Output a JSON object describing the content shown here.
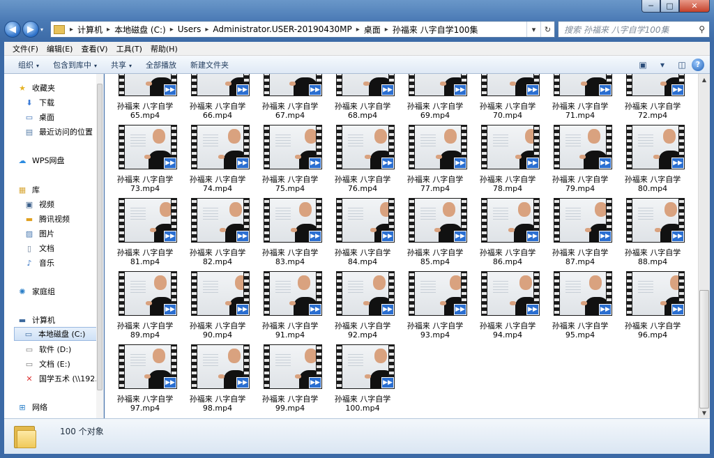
{
  "window": {
    "controls": {
      "minimize": "─",
      "maximize": "□",
      "close": "✕"
    }
  },
  "address": {
    "back_glyph": "◀",
    "forward_glyph": "▶",
    "dropdown_glyph": "▾",
    "crumbs": [
      "计算机",
      "本地磁盘 (C:)",
      "Users",
      "Administrator.USER-20190430MP",
      "桌面",
      "孙福来 八字自学100集"
    ],
    "crumb_sep": "▸",
    "dropdown": "▾",
    "refresh": "↻",
    "search_placeholder": "搜索 孙福来 八字自学100集",
    "search_glyph": "⚲"
  },
  "menubar": [
    "文件(F)",
    "编辑(E)",
    "查看(V)",
    "工具(T)",
    "帮助(H)"
  ],
  "commandbar": {
    "organize": "组织",
    "include_library": "包含到库中",
    "share": "共享",
    "play_all": "全部播放",
    "new_folder": "新建文件夹",
    "dd": "▾",
    "view_glyph": "▣",
    "pane_glyph": "◫",
    "help_glyph": "?"
  },
  "nav": {
    "favorites": "收藏夹",
    "downloads": "下载",
    "desktop": "桌面",
    "recent": "最近访问的位置",
    "wps": "WPS网盘",
    "libraries": "库",
    "videos": "视频",
    "tencent_video": "腾讯视频",
    "pictures": "图片",
    "documents": "文档",
    "music": "音乐",
    "homegroup": "家庭组",
    "computer": "计算机",
    "drive_c": "本地磁盘 (C:)",
    "drive_d": "软件 (D:)",
    "drive_e": "文档 (E:)",
    "netdrive": "国学五术 (\\\\192.",
    "network": "网络"
  },
  "files": {
    "name_prefix": "孙福来 八字自学",
    "ext": ".mp4",
    "first_visible": 65,
    "last": 100,
    "badge": "▶▶"
  },
  "details": {
    "count_text": "100 个对象"
  }
}
